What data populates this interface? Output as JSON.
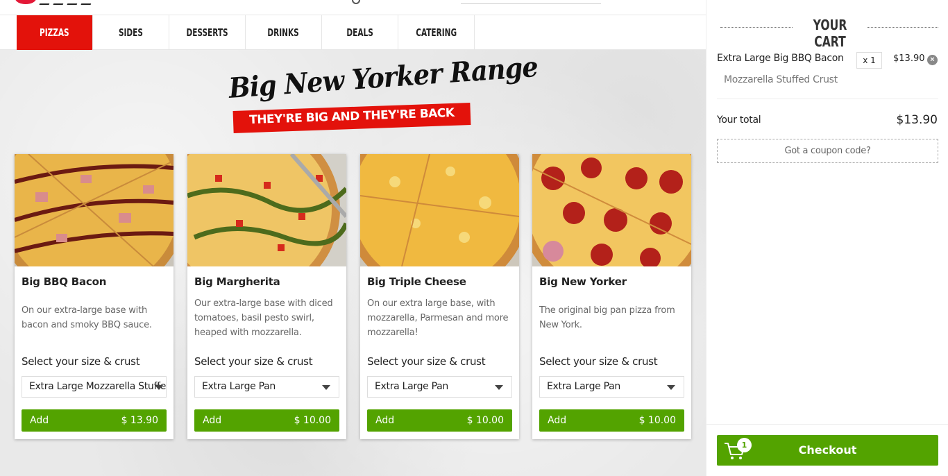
{
  "nav": {
    "items": [
      {
        "label": "PIZZAS",
        "active": true
      },
      {
        "label": "SIDES",
        "active": false
      },
      {
        "label": "DESSERTS",
        "active": false
      },
      {
        "label": "DRINKS",
        "active": false
      },
      {
        "label": "DEALS",
        "active": false
      },
      {
        "label": "CATERING",
        "active": false
      }
    ]
  },
  "banner": {
    "title": "Big New Yorker Range",
    "subtitle": "THEY'RE BIG AND THEY'RE BACK"
  },
  "products": [
    {
      "name": "Big BBQ Bacon",
      "description": "On our extra-large base with bacon and smoky BBQ sauce.",
      "select_label": "Select your size & crust",
      "selected_option": "Extra Large Mozzarella Stuffed Crust",
      "add_label": "Add",
      "price": "$ 13.90"
    },
    {
      "name": "Big Margherita",
      "description": "Our extra-large base with diced tomatoes, basil pesto swirl, heaped with mozzarella.",
      "select_label": "Select your size & crust",
      "selected_option": "Extra Large Pan",
      "add_label": "Add",
      "price": "$ 10.00"
    },
    {
      "name": "Big Triple Cheese",
      "description": "On our extra large base, with mozzarella, Parmesan and more mozzarella!",
      "select_label": "Select your size & crust",
      "selected_option": "Extra Large Pan",
      "add_label": "Add",
      "price": "$ 10.00"
    },
    {
      "name": "Big New Yorker",
      "description": "The original big pan pizza from New York.",
      "select_label": "Select your size & crust",
      "selected_option": "Extra Large Pan",
      "add_label": "Add",
      "price": "$ 10.00"
    }
  ],
  "cart": {
    "title": "YOUR CART",
    "item": {
      "name": "Extra Large Big BBQ Bacon",
      "qty": "x 1",
      "price": "$13.90",
      "option": "Mozzarella Stuffed Crust"
    },
    "total_label": "Your total",
    "total_value": "$13.90",
    "coupon_label": "Got a coupon code?",
    "checkout_label": "Checkout",
    "badge_count": "1"
  },
  "colors": {
    "brand_red": "#e3120b",
    "action_green": "#53a300"
  }
}
